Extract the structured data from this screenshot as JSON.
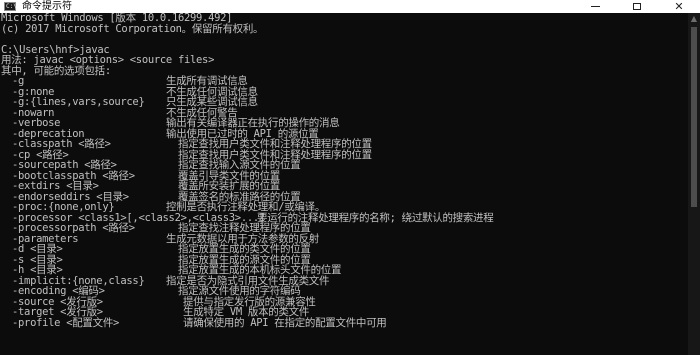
{
  "window": {
    "title": "命令提示符",
    "icon_text": "C:\\",
    "minimize_icon": "minimize-icon",
    "maximize_icon": "maximize-icon",
    "close_label": "✕"
  },
  "colors": {
    "background": "#0c0c0c",
    "text": "#c0c0c0",
    "titlebar": "#ffffff"
  },
  "console": {
    "header": [
      "Microsoft Windows [版本 10.0.16299.492]",
      "(c) 2017 Microsoft Corporation。保留所有权利。",
      "",
      "C:\\Users\\hnf>javac",
      "用法: javac <options> <source files>",
      "其中, 可能的选项包括:"
    ],
    "options": [
      {
        "opt": "-g",
        "desc": "生成所有调试信息"
      },
      {
        "opt": "-g:none",
        "desc": "不生成任何调试信息"
      },
      {
        "opt": "-g:{lines,vars,source}",
        "desc": "只生成某些调试信息"
      },
      {
        "opt": "-nowarn",
        "desc": "不生成任何警告"
      },
      {
        "opt": "-verbose",
        "desc": "输出有关编译器正在执行的操作的消息"
      },
      {
        "opt": "-deprecation",
        "desc": "输出使用已过时的 API 的源位置"
      },
      {
        "opt": "-classpath <路径>",
        "desc": "指定查找用户类文件和注释处理程序的位置"
      },
      {
        "opt": "-cp <路径>",
        "desc": "指定查找用户类文件和注释处理程序的位置"
      },
      {
        "opt": "-sourcepath <路径>",
        "desc": "指定查找输入源文件的位置"
      },
      {
        "opt": "-bootclasspath <路径>",
        "desc": "覆盖引导类文件的位置"
      },
      {
        "opt": "-extdirs <目录>",
        "desc": "覆盖所安装扩展的位置"
      },
      {
        "opt": "-endorseddirs <目录>",
        "desc": "覆盖签名的标准路径的位置"
      },
      {
        "opt": "-proc:{none,only}",
        "desc": "控制是否执行注释处理和/或编译。"
      },
      {
        "opt": "-processor <class1>[,<class2>,<class3>...]",
        "desc": "要运行的注释处理程序的名称; 绕过默认的搜索进程"
      },
      {
        "opt": "-processorpath <路径>",
        "desc": "指定查找注释处理程序的位置"
      },
      {
        "opt": "-parameters",
        "desc": "生成元数据以用于方法参数的反射"
      },
      {
        "opt": "-d <目录>",
        "desc": "指定放置生成的类文件的位置"
      },
      {
        "opt": "-s <目录>",
        "desc": "指定放置生成的源文件的位置"
      },
      {
        "opt": "-h <目录>",
        "desc": "指定放置生成的本机标头文件的位置"
      },
      {
        "opt": "-implicit:{none,class}",
        "desc": "指定是否为隐式引用文件生成类文件"
      },
      {
        "opt": "-encoding <编码>",
        "desc": "指定源文件使用的字符编码"
      },
      {
        "opt": "-source <发行版>",
        "desc": "提供与指定发行版的源兼容性"
      },
      {
        "opt": "-target <发行版>",
        "desc": "生成特定 VM 版本的类文件"
      },
      {
        "opt": "-profile <配置文件>",
        "desc": "请确保使用的 API 在指定的配置文件中可用"
      }
    ]
  }
}
